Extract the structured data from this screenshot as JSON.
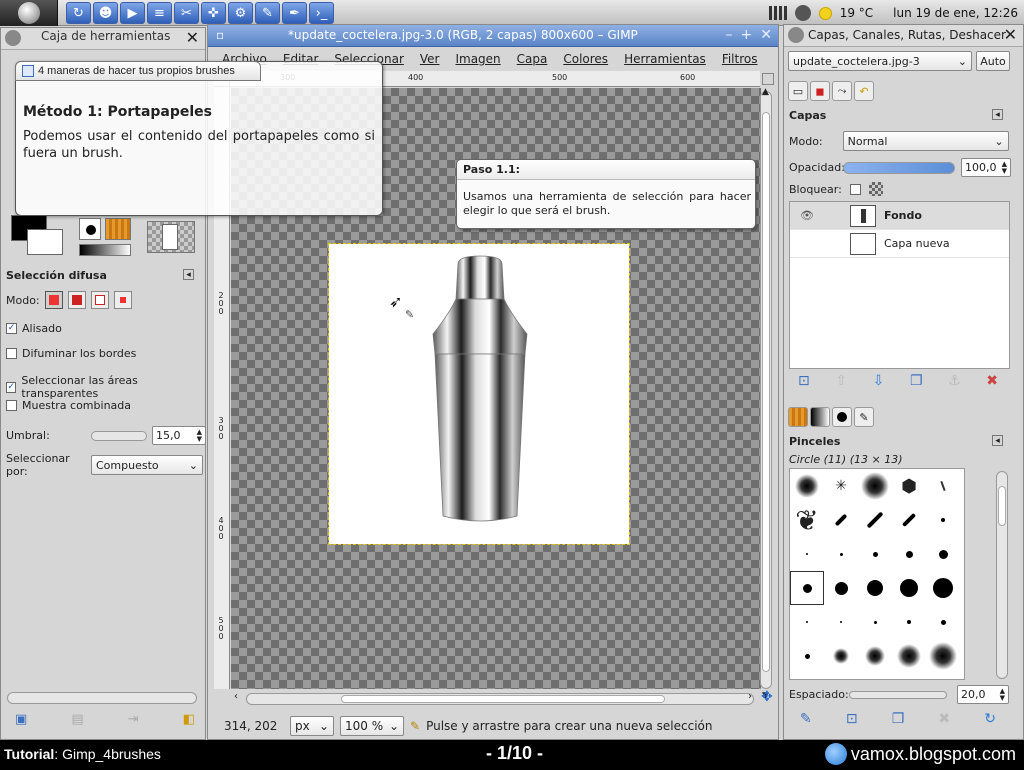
{
  "top_panel": {
    "temperature": "19 °C",
    "clock": "lun 19 de ene, 12:26"
  },
  "toolbox": {
    "title": "Caja de herramientas",
    "options_header": "Selección difusa",
    "mode_label": "Modo:",
    "antialias_label": "Alisado",
    "feather_label": "Difuminar los bordes",
    "select_transparent_label": "Seleccionar las áreas transparentes",
    "sample_merged_label": "Muestra combinada",
    "threshold_label": "Umbral:",
    "threshold_value": "15,0",
    "select_by_label": "Seleccionar por:",
    "select_by_value": "Compuesto"
  },
  "image_window": {
    "title": "*update_coctelera.jpg-3.0 (RGB, 2 capas) 800x600 – GIMP",
    "menu": [
      "Archivo",
      "Editar",
      "Seleccionar",
      "Ver",
      "Imagen",
      "Capa",
      "Colores",
      "Herramientas",
      "Filtros"
    ],
    "ruler_top": [
      "300",
      "400",
      "500",
      "600"
    ],
    "ruler_left": [
      "200",
      "300",
      "400",
      "500"
    ],
    "status": {
      "coords": "314, 202",
      "unit": "px",
      "zoom": "100 %",
      "message": "Pulse y arrastre para crear una nueva selección"
    }
  },
  "dock": {
    "title": "Capas, Canales, Rutas, Deshacer",
    "image_combo": "update_coctelera.jpg-3",
    "auto_button": "Auto",
    "layers_header": "Capas",
    "mode_label": "Modo:",
    "mode_value": "Normal",
    "opacity_label": "Opacidad:",
    "opacity_value": "100,0",
    "lock_label": "Bloquear:",
    "layers": [
      {
        "name": "Fondo",
        "selected": true
      },
      {
        "name": "Capa nueva",
        "selected": false
      }
    ],
    "brushes_header": "Pinceles",
    "brush_name": "Circle (11) (13 × 13)",
    "spacing_label": "Espaciado:",
    "spacing_value": "20,0"
  },
  "tutorial": {
    "tab_title": "4 maneras de hacer tus propios brushes",
    "heading": "Método 1: Portapapeles",
    "text": "Podemos usar el contenido del portapapeles como si fuera un brush.",
    "callout_title": "Paso 1.1:",
    "callout_text": "Usamos una herramienta de selección para hacer elegir lo que será el brush."
  },
  "bottom_bar": {
    "tutorial_label": "Tutorial",
    "tutorial_name": ": Gimp_4brushes",
    "page": "- 1/10 -",
    "site": "vamox.blogspot.com"
  }
}
